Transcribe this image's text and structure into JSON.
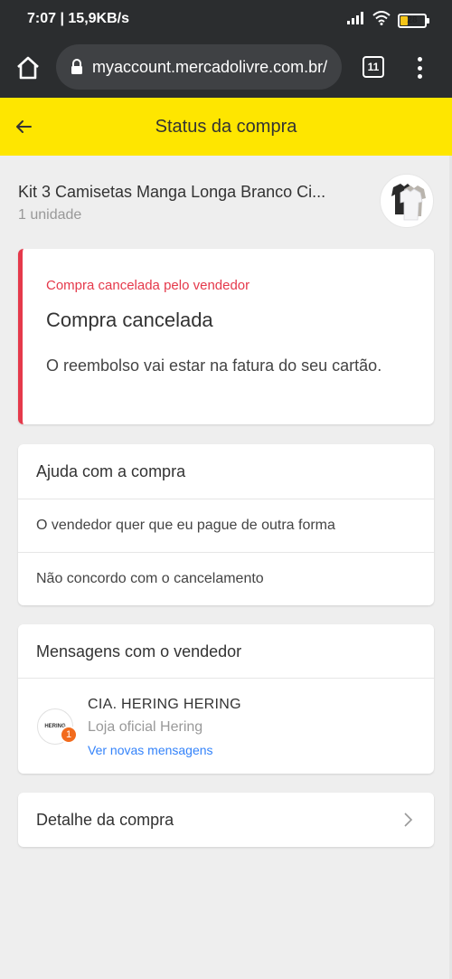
{
  "status_bar": {
    "time": "7:07 | 15,9KB/s",
    "battery": "28",
    "battery_level": 0.28,
    "icons": [
      "signal-icon",
      "wifi-icon",
      "battery-icon"
    ]
  },
  "browser": {
    "url": "myaccount.mercadolivre.com.br/",
    "tab_count": "11"
  },
  "header": {
    "title": "Status da compra"
  },
  "product": {
    "name": "Kit 3 Camisetas Manga Longa Branco Ci...",
    "quantity": "1 unidade"
  },
  "cancel_notice": {
    "overline": "Compra cancelada pelo vendedor",
    "title": "Compra cancelada",
    "description": "O reembolso vai estar na fatura do seu cartão."
  },
  "help": {
    "title": "Ajuda com a compra",
    "options": [
      "O vendedor quer que eu pague de outra forma",
      "Não concordo com o cancelamento"
    ]
  },
  "messages": {
    "title": "Mensagens com o vendedor",
    "seller_name": "CIA. HERING HERING",
    "seller_subtitle": "Loja oficial Hering",
    "link": "Ver novas mensagens",
    "unread_count": "1",
    "avatar_text": "HERING"
  },
  "detail": {
    "label": "Detalhe da compra"
  },
  "colors": {
    "header_yellow": "#fee600",
    "danger_red": "#e5394b",
    "link_blue": "#3483fa",
    "badge_orange": "#f26b1d",
    "browser_dark": "#2b2d2f"
  }
}
